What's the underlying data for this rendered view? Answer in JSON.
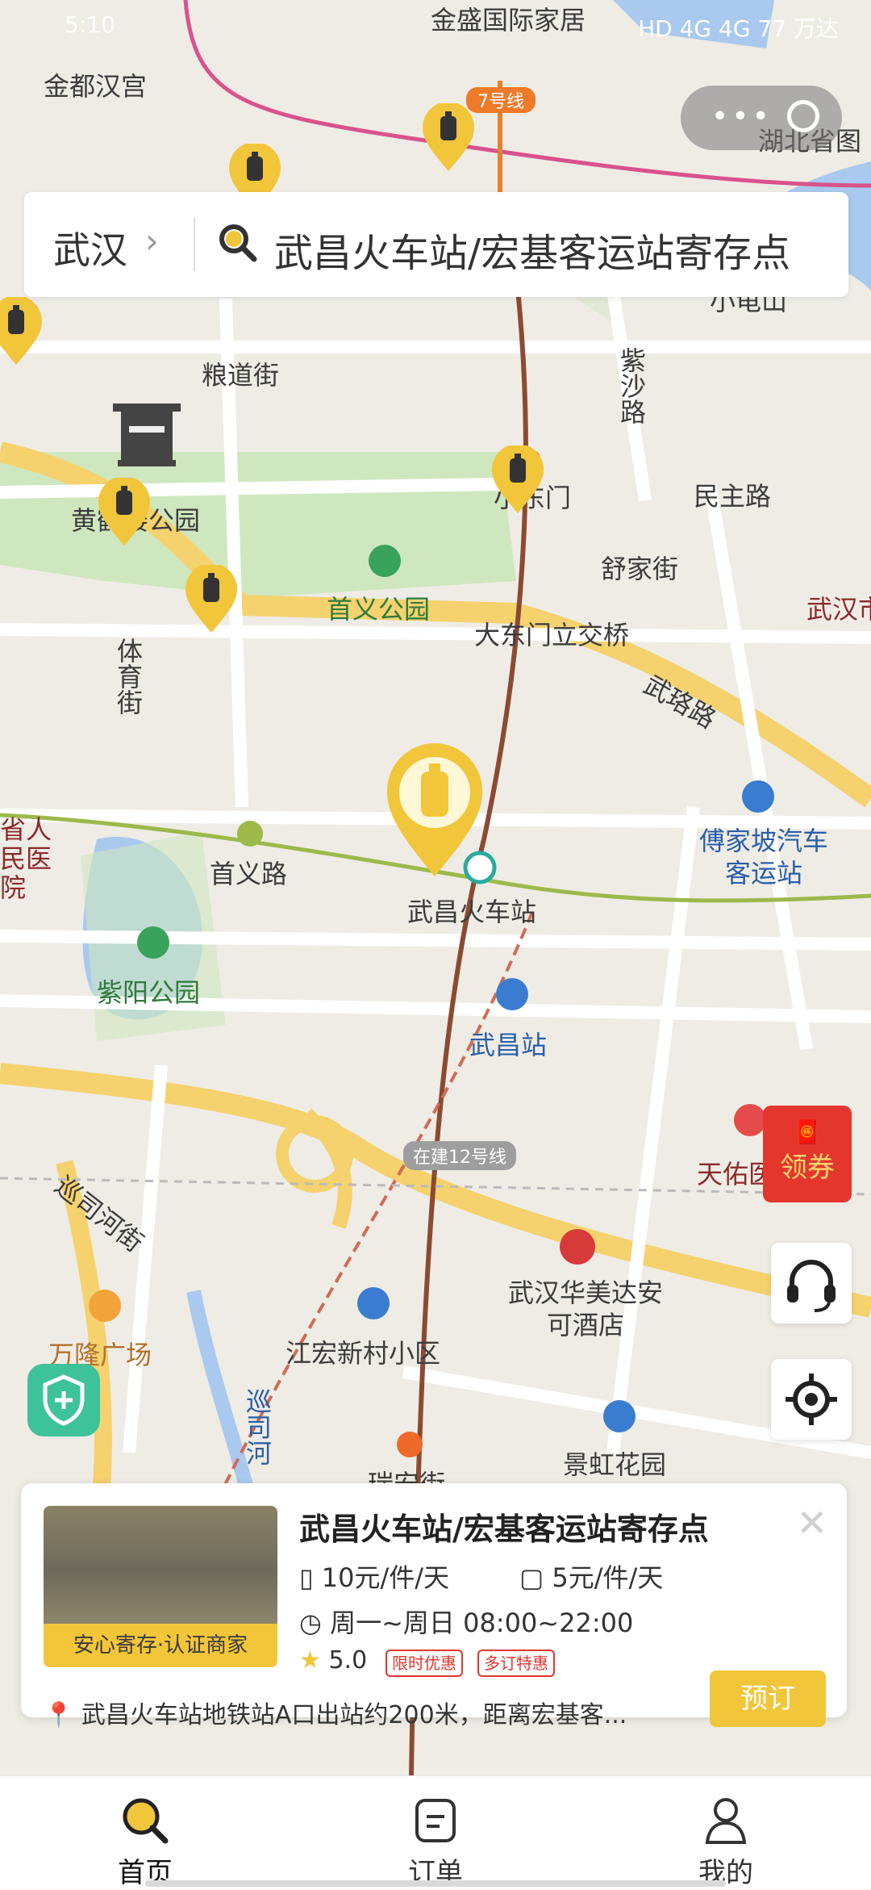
{
  "status_bar": {
    "time": "5:10",
    "net": "HD 4G 4G",
    "battery": "77",
    "extra": "万达"
  },
  "search": {
    "city": "武汉",
    "query": "武昌火车站/宏基客运站寄存点"
  },
  "map_labels": {
    "top_mall": "金盛国际家居",
    "jindu": "金都汉宫",
    "line7": "7号线",
    "hubei": "湖北省图",
    "hubo": "小龟山",
    "liangdao": "粮道街",
    "zisha": "紫沙路",
    "xiaodongmen": "小东门",
    "minzhu": "民主路",
    "huanghe": "黄鹤楼公园",
    "shuyi_park": "首义公园",
    "shujia": "舒家街",
    "wuhan_right": "武汉市",
    "dadongmen": "大东门立交桥",
    "wulu": "武珞路",
    "tiyu": "体育街",
    "people": "省人民医院",
    "shouyi_road": "首义路",
    "fujiapo": "傅家坡汽车客运站",
    "wuchang_hcz": "武昌火车站",
    "ziyang": "紫阳公园",
    "wuchang_st": "武昌站",
    "line12": "在建12号线",
    "tianyou": "天佑医",
    "xunsi": "巡司河街",
    "huameida": "武汉华美达安可酒店",
    "wanlong": "万隆广场",
    "jianghong": "江宏新村小区",
    "xunsi_river": "巡司河",
    "jinghong": "景虹花园",
    "ruian": "瑞安街"
  },
  "coupon": {
    "label": "领券"
  },
  "card": {
    "title": "武昌火车站/宏基客运站寄存点",
    "badge": "安心寄存·认证商家",
    "price_large": "10元/件/天",
    "price_small": "5元/件/天",
    "hours": "周一~周日 08:00~22:00",
    "rating": "5.0",
    "tag1": "限时优惠",
    "tag2": "多订特惠",
    "address": "武昌火车站地铁站A口出站约200米，距离宏基客...",
    "book": "预订"
  },
  "tabs": {
    "home": "首页",
    "orders": "订单",
    "mine": "我的"
  },
  "colors": {
    "accent": "#F2C63A",
    "road": "#F5D26E",
    "park": "#C9E6B8",
    "water": "#A9C9EE"
  }
}
